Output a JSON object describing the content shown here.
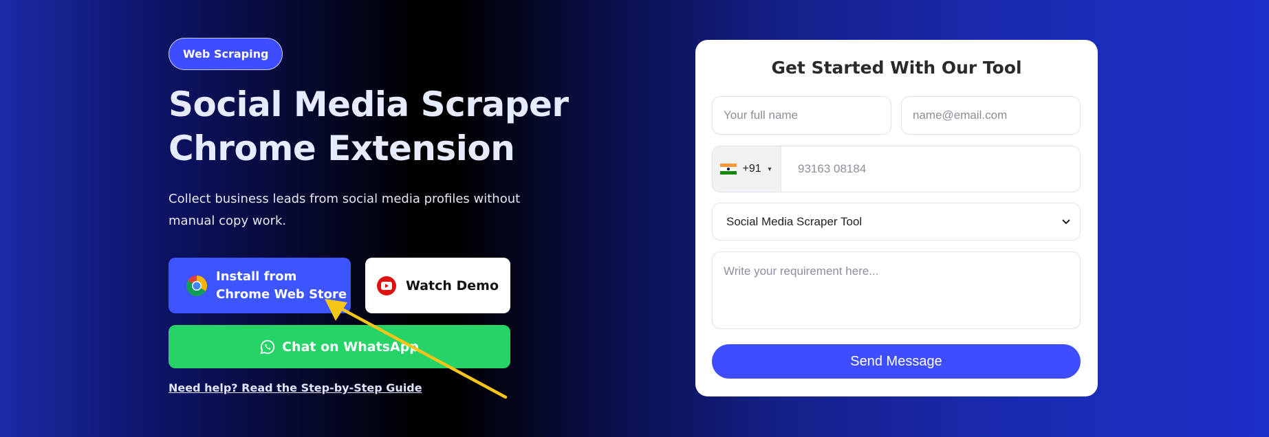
{
  "hero": {
    "badge": "Web Scraping",
    "title_line1": "Social Media Scraper",
    "title_line2": "Chrome Extension",
    "subtitle": "Collect business leads from social media profiles without manual copy work.",
    "install_line1": "Install from",
    "install_line2": "Chrome Web Store",
    "demo_label": "Watch Demo",
    "whatsapp_label": "Chat on WhatsApp",
    "help_link": "Need help? Read the Step-by-Step Guide"
  },
  "form": {
    "title": "Get Started With Our Tool",
    "name_placeholder": "Your full name",
    "email_placeholder": "name@email.com",
    "country_code": "+91",
    "phone_placeholder": "93163 08184",
    "select_value": "Social Media Scraper Tool",
    "textarea_placeholder": "Write your requirement here...",
    "submit_label": "Send Message"
  },
  "colors": {
    "primary": "#3d4dff",
    "whatsapp": "#25d366",
    "annotation_arrow": "#f5c518"
  },
  "icons": [
    "chrome-icon",
    "youtube-icon",
    "whatsapp-icon",
    "india-flag-icon",
    "chevron-down-icon"
  ]
}
